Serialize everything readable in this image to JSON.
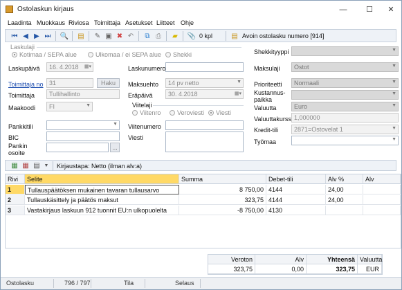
{
  "window": {
    "title": "Ostolaskun kirjaus",
    "minimize": "—",
    "maximize": "☐",
    "close": "✕"
  },
  "menu": [
    "Laadinta",
    "Muokkaus",
    "Riviosa",
    "Toimittaja",
    "Asetukset",
    "Liitteet",
    "Ohje"
  ],
  "toolbar": {
    "attachments": "0 kpl",
    "open_invoice": "Avoin ostolasku numero [914]"
  },
  "form": {
    "laskulaji_label": "Laskulaji",
    "laskulaji_options": [
      "Kotimaa / SEPA alue",
      "Ulkomaa / ei SEPA alue",
      "Shekki"
    ],
    "shekkityyppi_label": "Shekkityyppi",
    "shekkityyppi_value": "",
    "laskupaiva_label": "Laskupäivä",
    "laskupaiva_value": "16. 4.2018",
    "laskunumero_label": "Laskunumero",
    "laskunumero_value": "",
    "maksulaji_label": "Maksulaji",
    "maksulaji_value": "Ostot",
    "toimittaja_no_label": "Toimittaja no",
    "toimittaja_no_value": "31",
    "haku_label": "Haku",
    "maksuehto_label": "Maksuehto",
    "maksuehto_value": "14 pv netto",
    "prioriteetti_label": "Prioriteetti",
    "prioriteetti_value": "Normaali",
    "toimittaja_label": "Toimittaja",
    "toimittaja_value": "Tullihallinto",
    "erapaiva_label": "Eräpäivä",
    "erapaiva_value": "30. 4.2018",
    "kustannuspaikka_label": "Kustannus- paikka",
    "kustannuspaikka_value": "",
    "maakoodi_label": "Maakoodi",
    "maakoodi_value": "FI",
    "viitelaji_label": "Viitelaji",
    "viitelaji_options": [
      "Viitenro",
      "Veroviesti",
      "Viesti"
    ],
    "valuutta_label": "Valuutta",
    "valuutta_value": "Euro",
    "valuuttakurssi_label": "Valuuttakurssi",
    "valuuttakurssi_value": "1,000000",
    "pankkitili_label": "Pankkitili",
    "pankkitili_value": "",
    "viitenumero_label": "Viitenumero",
    "viitenumero_value": "",
    "kredit_label": "Kredit-tili",
    "kredit_value": "2871=Ostovelat 1",
    "bic_label": "BIC",
    "bic_value": "",
    "viesti_label": "Viesti",
    "viesti_value": "",
    "tyomaa_label": "Työmaa",
    "tyomaa_value": "",
    "pankin_osoite_label": "Pankin osoite",
    "pankin_osoite_value": "",
    "ellipsis": "..."
  },
  "grid_toolbar": {
    "mode": "Kirjaustapa: Netto (ilman alv:a)"
  },
  "grid": {
    "headers": [
      "Rivi",
      "Selite",
      "Summa",
      "Debet-tili",
      "Alv %",
      "Alv"
    ],
    "rows": [
      {
        "rivi": "1",
        "selite": "Tullauspäätöksen mukainen tavaran tullausarvo",
        "summa": "8 750,00",
        "debet": "4144",
        "alvp": "24,00",
        "alv": ""
      },
      {
        "rivi": "2",
        "selite": "Tullauskäsittely ja päätös maksut",
        "summa": "323,75",
        "debet": "4144",
        "alvp": "24,00",
        "alv": ""
      },
      {
        "rivi": "3",
        "selite": "Vastakirjaus laskuun 912 tuonnit EU:n ulkopuolelta",
        "summa": "-8 750,00",
        "debet": "4130",
        "alvp": "",
        "alv": ""
      }
    ]
  },
  "totals": {
    "headers": [
      "Veroton",
      "Alv",
      "Yhteensä",
      "Valuutta"
    ],
    "values": [
      "323,75",
      "0,00",
      "323,75",
      "EUR"
    ]
  },
  "status": {
    "left": "Ostolasku",
    "count": "796 / 797",
    "tila": "Tila",
    "selaus": "Selaus"
  }
}
